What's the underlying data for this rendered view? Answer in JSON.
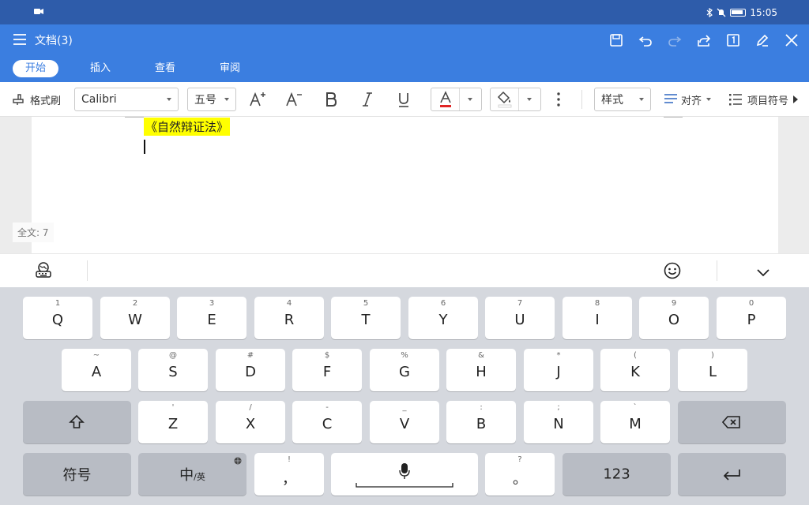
{
  "status_bar": {
    "time": "15:05"
  },
  "app_bar": {
    "title": "文档(3)",
    "tabs": [
      {
        "label": "开始",
        "active": true
      },
      {
        "label": "插入",
        "active": false
      },
      {
        "label": "查看",
        "active": false
      },
      {
        "label": "审阅",
        "active": false
      }
    ]
  },
  "toolbar": {
    "format_painter": "格式刷",
    "font_name": "Calibri",
    "font_size": "五号",
    "style": "样式",
    "align": "对齐",
    "bullets": "项目符号"
  },
  "document": {
    "text": "《自然辩证法》",
    "word_count": "全文: 7"
  },
  "keyboard": {
    "row1": [
      {
        "sub": "1",
        "main": "Q"
      },
      {
        "sub": "2",
        "main": "W"
      },
      {
        "sub": "3",
        "main": "E"
      },
      {
        "sub": "4",
        "main": "R"
      },
      {
        "sub": "5",
        "main": "T"
      },
      {
        "sub": "6",
        "main": "Y"
      },
      {
        "sub": "7",
        "main": "U"
      },
      {
        "sub": "8",
        "main": "I"
      },
      {
        "sub": "9",
        "main": "O"
      },
      {
        "sub": "0",
        "main": "P"
      }
    ],
    "row2": [
      {
        "sub": "~",
        "main": "A"
      },
      {
        "sub": "@",
        "main": "S"
      },
      {
        "sub": "#",
        "main": "D"
      },
      {
        "sub": "$",
        "main": "F"
      },
      {
        "sub": "%",
        "main": "G"
      },
      {
        "sub": "&",
        "main": "H"
      },
      {
        "sub": "*",
        "main": "J"
      },
      {
        "sub": "(",
        "main": "K"
      },
      {
        "sub": ")",
        "main": "L"
      }
    ],
    "row3": [
      {
        "sub": "'",
        "main": "Z"
      },
      {
        "sub": "/",
        "main": "X"
      },
      {
        "sub": "-",
        "main": "C"
      },
      {
        "sub": "_",
        "main": "V"
      },
      {
        "sub": ":",
        "main": "B"
      },
      {
        "sub": ";",
        "main": "N"
      },
      {
        "sub": "`",
        "main": "M"
      }
    ],
    "symbols": "符号",
    "lang_main": "中",
    "lang_sub": "/英",
    "comma_sub": "!",
    "comma": "，",
    "period_sub": "?",
    "period": "。",
    "num": "123"
  },
  "colors": {
    "accent": "#3b7ee0",
    "status": "#2e5caa",
    "highlight": "#ffff00"
  }
}
